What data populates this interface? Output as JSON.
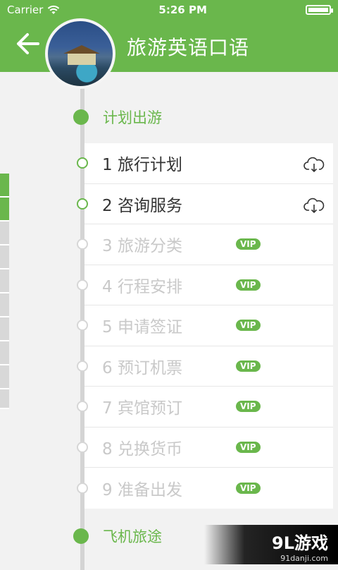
{
  "status_bar": {
    "carrier": "Carrier",
    "time": "5:26 PM",
    "wifi_icon": "wifi-icon",
    "battery_icon": "battery-icon"
  },
  "header": {
    "title": "旅游英语口语",
    "back_icon": "back-arrow-icon",
    "accent_color": "#6ab74c"
  },
  "sections": [
    {
      "label": "计划出游"
    },
    {
      "label": "飞机旅途"
    }
  ],
  "lessons": [
    {
      "label": "1 旅行计划",
      "badge": "",
      "icon": "cloud-download-icon",
      "active": true
    },
    {
      "label": "2 咨询服务",
      "badge": "",
      "icon": "cloud-download-icon",
      "active": true
    },
    {
      "label": "3 旅游分类",
      "badge": "VIP",
      "active": false
    },
    {
      "label": "4 行程安排",
      "badge": "VIP",
      "active": false
    },
    {
      "label": "5 申请签证",
      "badge": "VIP",
      "active": false
    },
    {
      "label": "6 预订机票",
      "badge": "VIP",
      "active": false
    },
    {
      "label": "7 宾馆预订",
      "badge": "VIP",
      "active": false
    },
    {
      "label": "8 兑换货币",
      "badge": "VIP",
      "active": false
    },
    {
      "label": "9 准备出发",
      "badge": "VIP",
      "active": false
    }
  ],
  "watermark": {
    "brand": "9L游戏",
    "site": "91danji.com"
  }
}
